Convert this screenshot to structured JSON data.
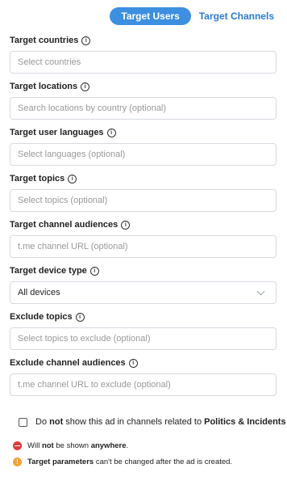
{
  "tabs": {
    "target_users": "Target Users",
    "target_channels": "Target Channels"
  },
  "fields": [
    {
      "label": "Target countries",
      "placeholder": "Select countries"
    },
    {
      "label": "Target locations",
      "placeholder": "Search locations by country (optional)"
    },
    {
      "label": "Target user languages",
      "placeholder": "Select languages (optional)"
    },
    {
      "label": "Target topics",
      "placeholder": "Select topics (optional)"
    },
    {
      "label": "Target channel audiences",
      "placeholder": "t.me channel URL (optional)"
    },
    {
      "label": "Target device type",
      "value": "All devices"
    },
    {
      "label": "Exclude topics",
      "placeholder": "Select topics to exclude (optional)"
    },
    {
      "label": "Exclude channel audiences",
      "placeholder": "t.me channel URL to exclude (optional)"
    }
  ],
  "info_glyph": "i",
  "checkbox": {
    "pre": "Do ",
    "bold_not": "not",
    "mid": " show this ad in channels related to ",
    "bold_topic": "Politics & Incidents",
    "checked": false
  },
  "notices": [
    {
      "icon": "minus-circle-icon",
      "pre": "Will ",
      "bold1": "not",
      "mid": " be shown ",
      "bold2": "anywhere",
      "post": "."
    },
    {
      "icon": "exclamation-circle-icon",
      "bold1": "Target parameters",
      "post": " can't be changed after the ad is created.",
      "glyph": "!"
    }
  ],
  "colors": {
    "accent": "#3d8fe0",
    "link": "#2a7bd6",
    "danger": "#e0393e",
    "warning": "#f0a23a"
  }
}
